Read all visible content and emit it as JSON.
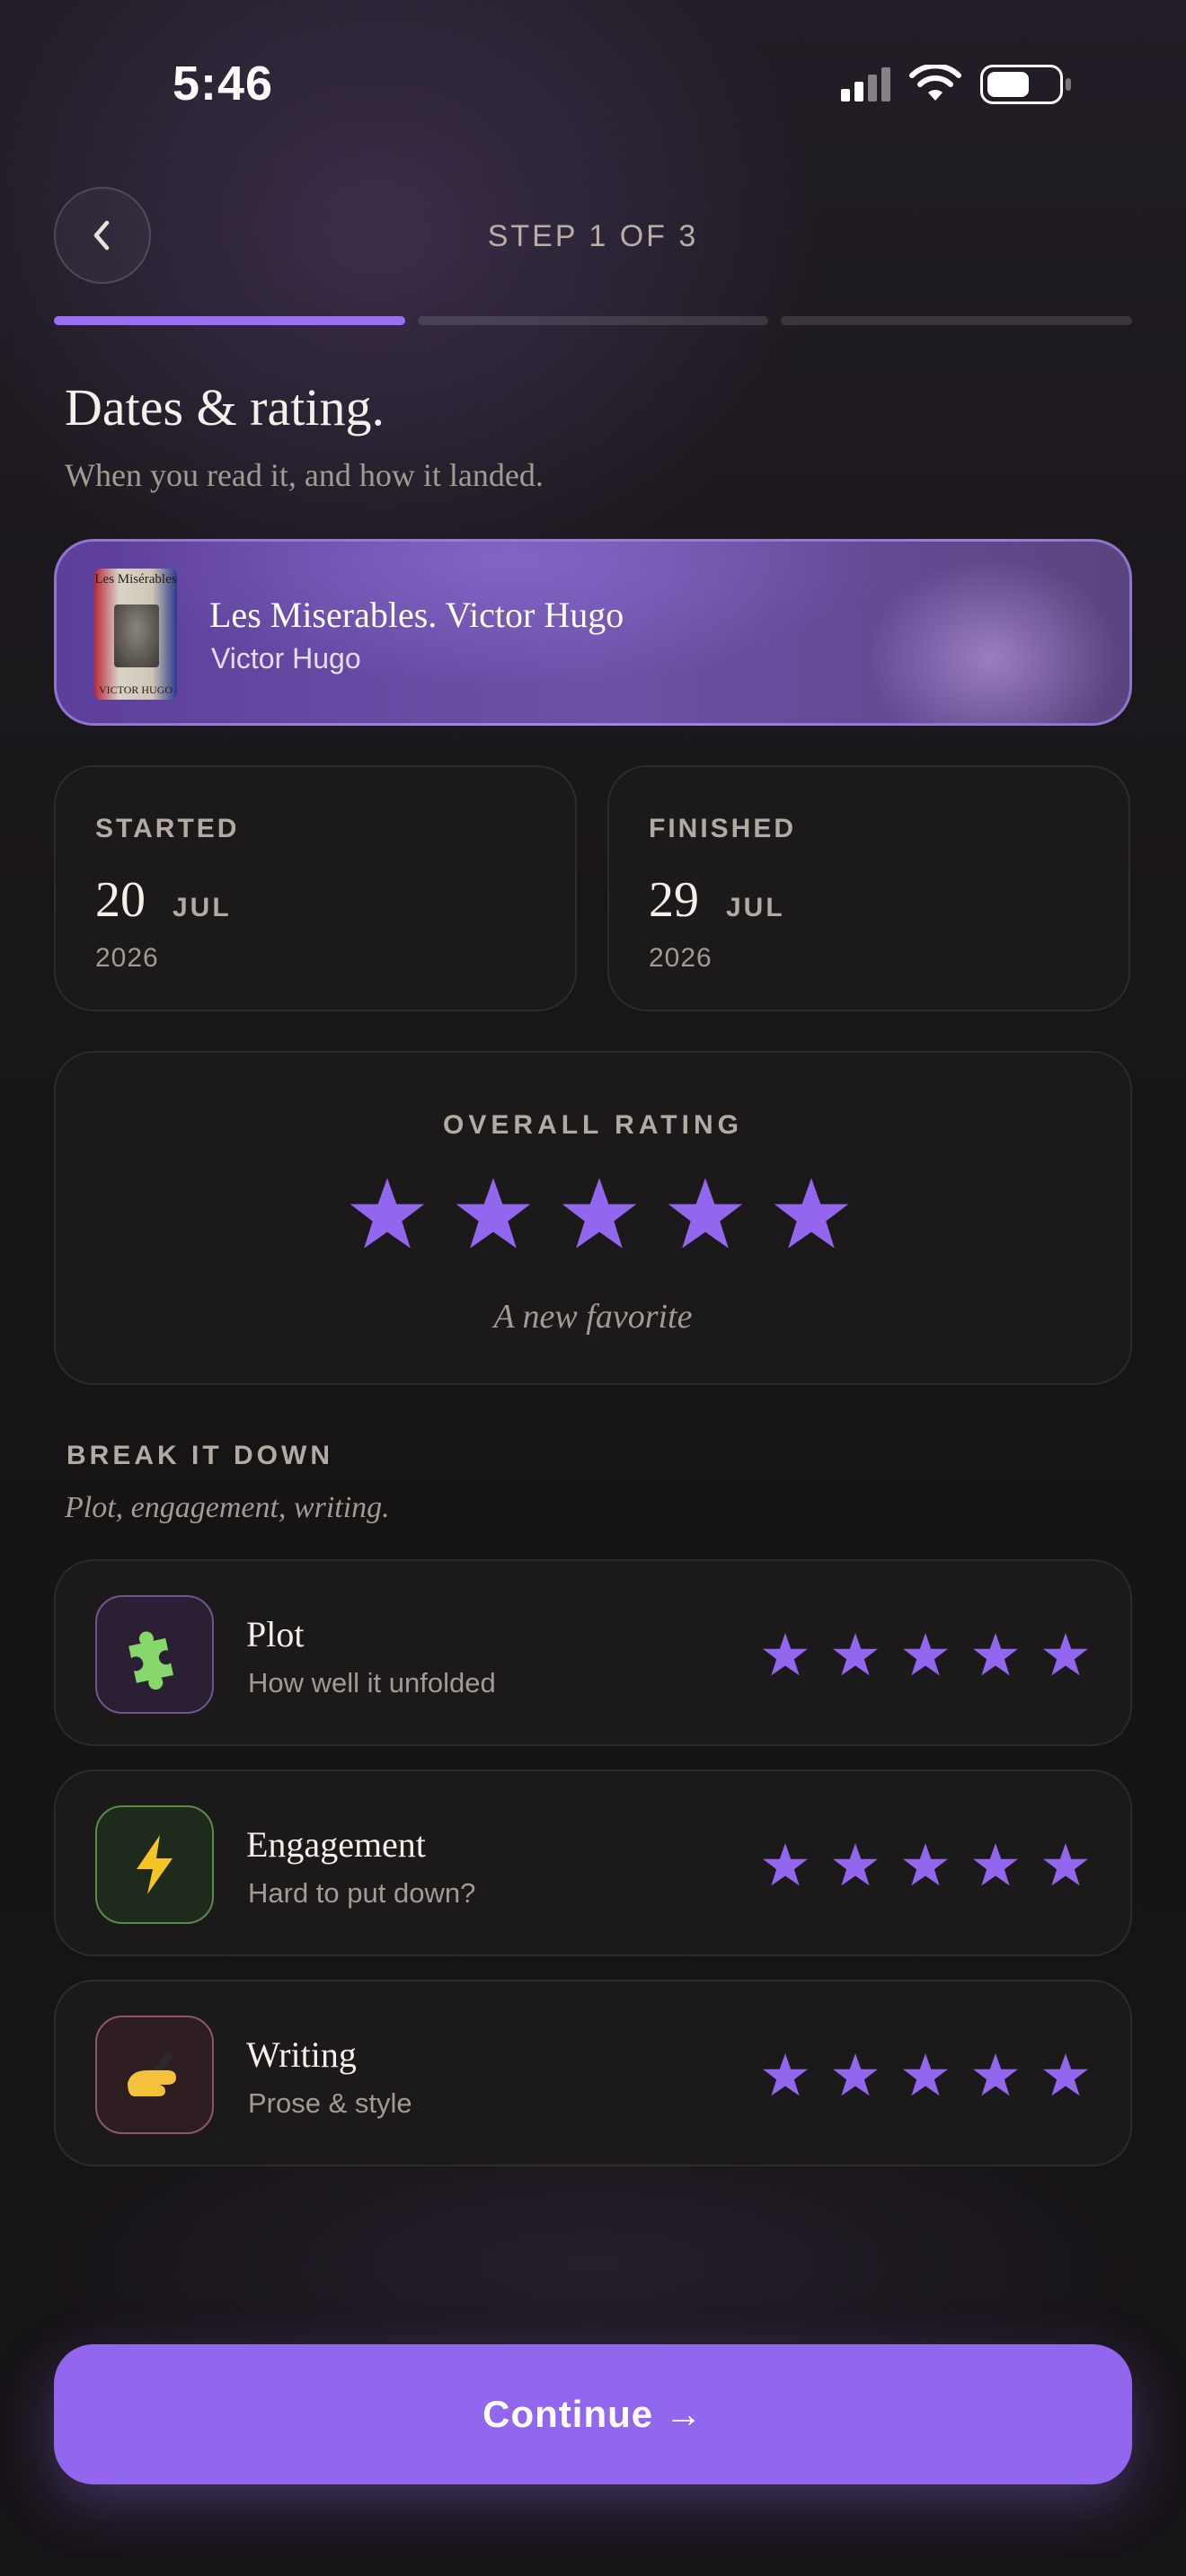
{
  "status_bar": {
    "time": "5:46"
  },
  "header": {
    "step_label": "STEP 1 OF 3",
    "total_steps": 3,
    "current_step": 1
  },
  "page": {
    "title": "Dates & rating.",
    "subtitle": "When you read it, and how it landed."
  },
  "book": {
    "title": "Les Miserables. Victor Hugo",
    "author": "Victor Hugo",
    "cover": {
      "top_text": "Les Misérables",
      "bottom_text": "VICTOR HUGO"
    }
  },
  "dates": {
    "started": {
      "label": "STARTED",
      "day": "20",
      "month": "JUL",
      "year": "2026"
    },
    "finished": {
      "label": "FINISHED",
      "day": "29",
      "month": "JUL",
      "year": "2026"
    }
  },
  "overall_rating": {
    "label": "OVERALL RATING",
    "value": 5,
    "max": 5,
    "verdict": "A new favorite"
  },
  "breakdown": {
    "label": "BREAK IT DOWN",
    "subtitle": "Plot, engagement, writing.",
    "items": [
      {
        "name": "Plot",
        "description": "How well it unfolded",
        "icon": "puzzle-icon",
        "rating": 5,
        "max": 5
      },
      {
        "name": "Engagement",
        "description": "Hard to put down?",
        "icon": "lightning-icon",
        "rating": 5,
        "max": 5
      },
      {
        "name": "Writing",
        "description": "Prose & style",
        "icon": "writing-hand-icon",
        "rating": 5,
        "max": 5
      }
    ]
  },
  "colors": {
    "accent": "#9366EE",
    "background": "#151314",
    "card": "#1C1A1B"
  },
  "continue_button": {
    "label": "Continue →"
  }
}
